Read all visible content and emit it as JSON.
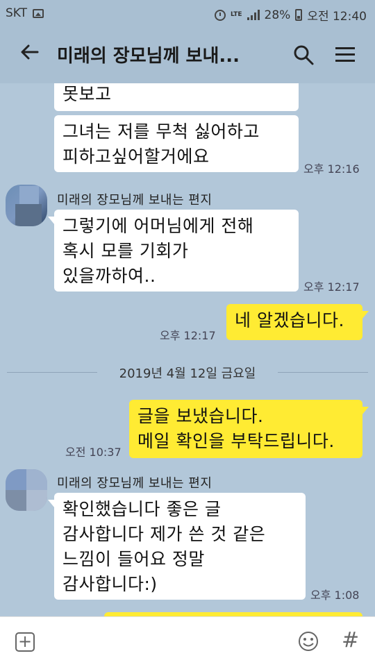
{
  "status_bar": {
    "carrier": "SKT",
    "network": "LTE",
    "battery": "28%",
    "time": "오전 12:40"
  },
  "header": {
    "title": "미래의 장모님께 보내..."
  },
  "messages": {
    "m1_text": "못보고",
    "m2_text": "그녀는 저를 무척 싫어하고\n피하고싶어할거에요",
    "m2_time": "오후 12:16",
    "sender1": "미래의 장모님께 보내는 편지",
    "m3_text": "그렇기에 어머님에게 전해\n혹시 모를 기회가\n있을까하여..",
    "m3_time": "오후 12:17",
    "m4_text": "네 알겠습니다.",
    "m4_time": "오후 12:17",
    "date_separator": "2019년 4월 12일 금요일",
    "m5_text": "글을 보냈습니다.\n메일 확인을 부탁드립니다.",
    "m5_time": "오전 10:37",
    "sender2": "미래의 장모님께 보내는 편지",
    "m6_text": "확인했습니다 좋은 글\n감사합니다 제가 쓴 것 같은\n느낌이 들어요 정말\n감사합니다:)",
    "m6_time": "오후 1:08"
  },
  "input_bar": {
    "hash": "#"
  },
  "colors": {
    "background": "#b2c7d9",
    "header": "#a9bfd2",
    "my_bubble": "#ffeb33",
    "their_bubble": "#ffffff"
  }
}
